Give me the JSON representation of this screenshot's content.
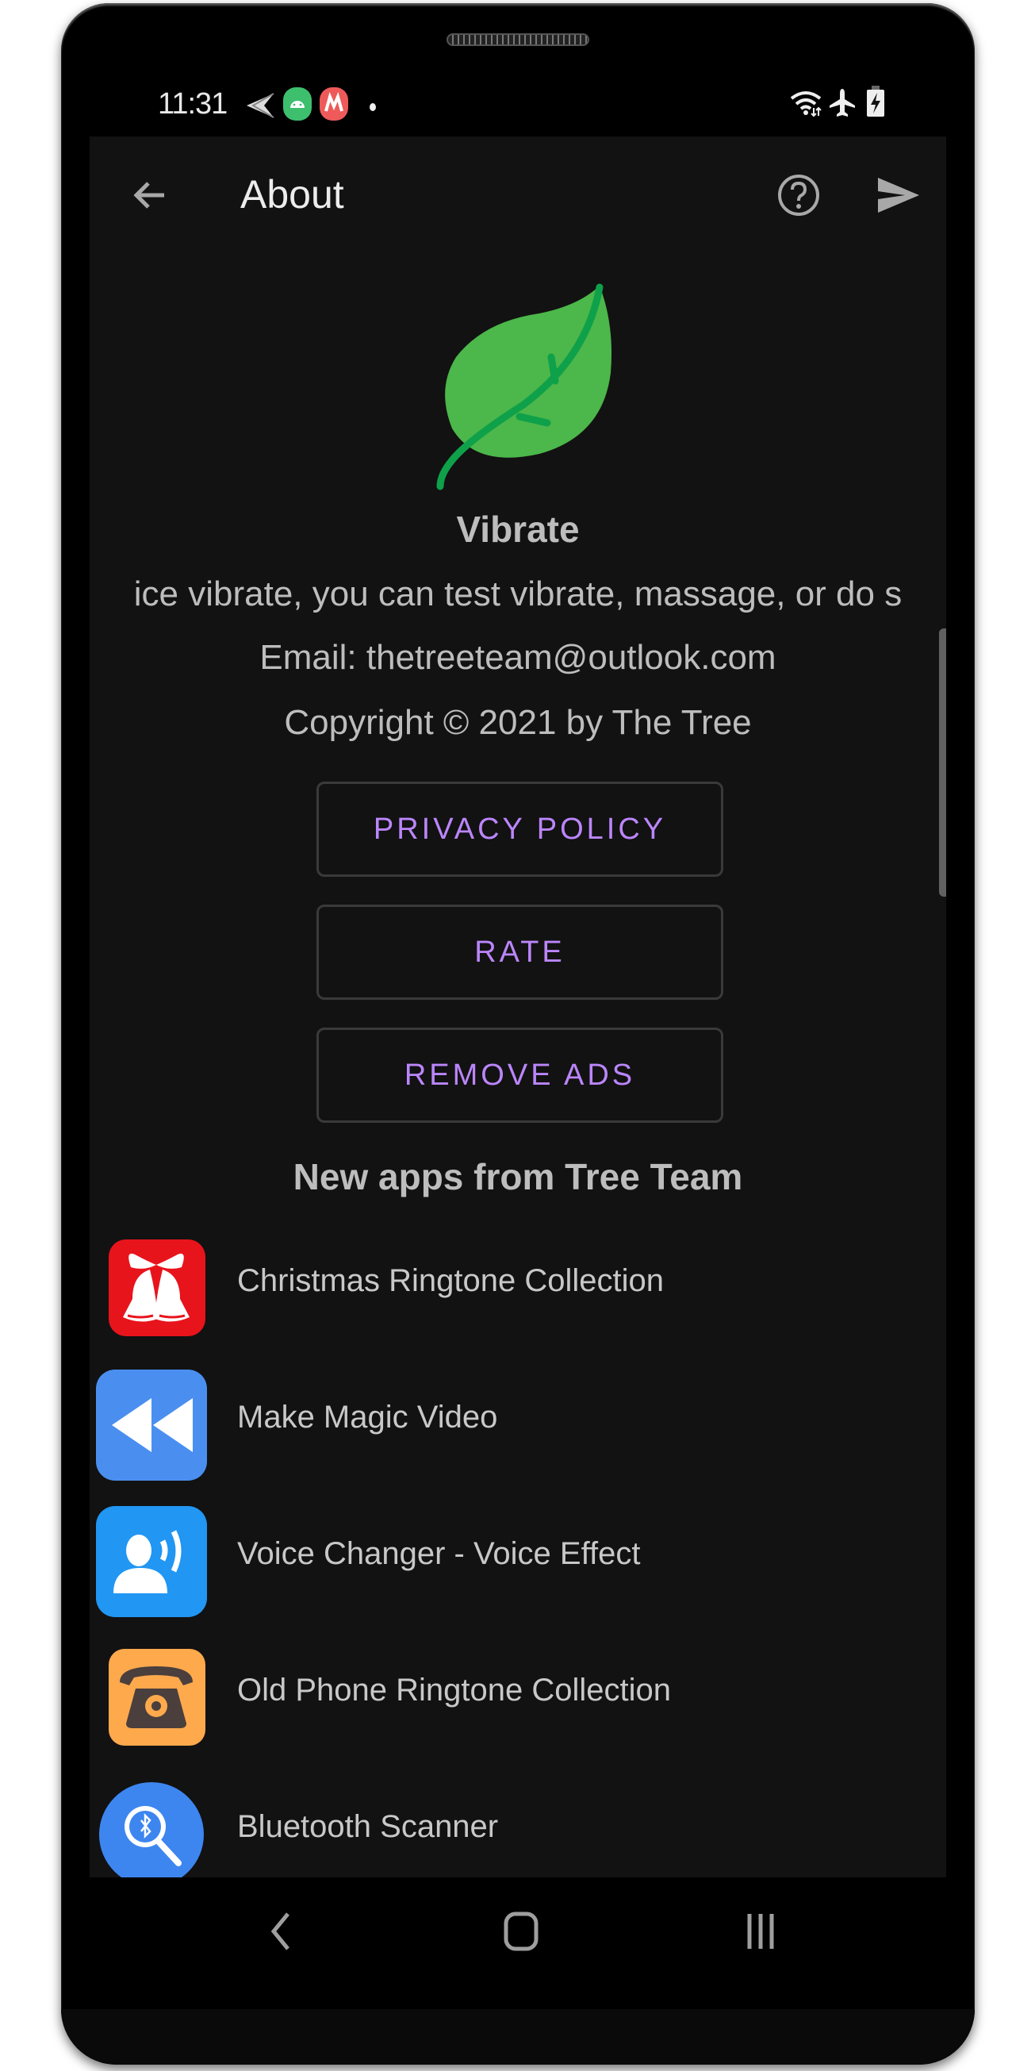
{
  "status_bar": {
    "time": "11:31",
    "left_icons": [
      "send-notification-icon",
      "android-app-icon",
      "motorola-app-icon",
      "more-dot-icon"
    ],
    "right_icons": [
      "wifi-icon",
      "airplane-mode-icon",
      "battery-charging-icon"
    ]
  },
  "app_bar": {
    "title": "About",
    "back_icon": "arrow-back-icon",
    "help_icon": "help-circle-icon",
    "share_icon": "send-icon"
  },
  "about": {
    "logo": "leaf-icon",
    "logo_color": "#4CB74A",
    "app_name": "Vibrate",
    "description": "Make your device vibrate, you can test vibrate, massage, or do something fun",
    "description_visible": "ice vibrate, you can test vibrate, massage, or do s",
    "email": "Email: thetreeteam@outlook.com",
    "copyright": "Copyright © 2021 by The Tree"
  },
  "buttons": {
    "privacy_policy": "PRIVACY POLICY",
    "rate": "RATE",
    "remove_ads": "REMOVE ADS",
    "accent_color": "#BB86FC"
  },
  "more_apps": {
    "title": "New apps from Tree Team",
    "items": [
      {
        "label": "Christmas Ringtone Collection",
        "icon": "christmas-bells-icon",
        "color": "#E8141C"
      },
      {
        "label": "Make Magic Video",
        "icon": "rewind-icon",
        "color": "#4A8FF0"
      },
      {
        "label": "Voice Changer - Voice Effect",
        "icon": "voice-speaker-icon",
        "color": "#2196F3"
      },
      {
        "label": "Old Phone Ringtone Collection",
        "icon": "rotary-phone-icon",
        "color": "#FFA94D"
      },
      {
        "label": "Bluetooth Scanner",
        "icon": "bluetooth-search-icon",
        "color": "#3D86F0"
      }
    ]
  },
  "nav_bar": {
    "back": "nav-back-icon",
    "home": "nav-home-icon",
    "recents": "nav-recents-icon"
  }
}
